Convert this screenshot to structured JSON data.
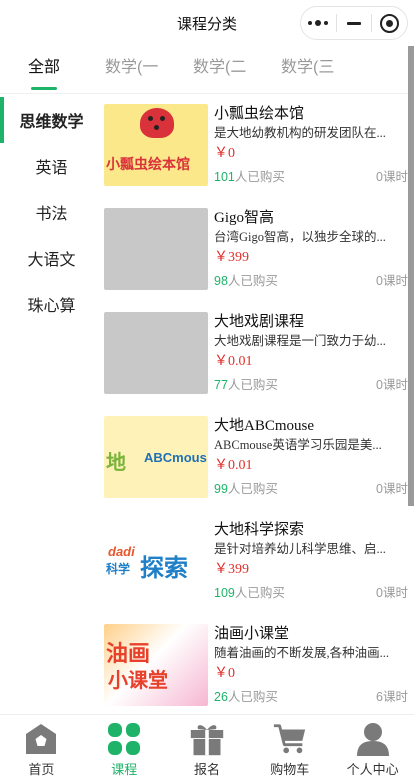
{
  "header": {
    "title": "课程分类"
  },
  "tabs": [
    {
      "label": "全部",
      "active": true
    },
    {
      "label": "数学(一",
      "active": false
    },
    {
      "label": "数学(二",
      "active": false
    },
    {
      "label": "数学(三",
      "active": false
    }
  ],
  "sidebar": {
    "items": [
      {
        "label": "思维数学",
        "active": true
      },
      {
        "label": "英语",
        "active": false
      },
      {
        "label": "书法",
        "active": false
      },
      {
        "label": "大语文",
        "active": false
      },
      {
        "label": "珠心算",
        "active": false
      }
    ]
  },
  "courses": [
    {
      "name": "小瓢虫绘本馆",
      "desc": "是大地幼教机构的研发团队在...",
      "price": "￥0",
      "count": "101",
      "count_suffix": "人已购买",
      "lessons": "0课时",
      "thumb_text": "小瓢虫绘本馆"
    },
    {
      "name": "Gigo智高",
      "desc": "台湾Gigo智高，以独步全球的...",
      "price": "￥399",
      "count": "98",
      "count_suffix": "人已购买",
      "lessons": "0课时"
    },
    {
      "name": "大地戏剧课程",
      "desc": "大地戏剧课程是一门致力于幼...",
      "price": "￥0.01",
      "count": "77",
      "count_suffix": "人已购买",
      "lessons": "0课时"
    },
    {
      "name": "大地ABCmouse",
      "desc": "ABCmouse英语学习乐园是美...",
      "price": "￥0.01",
      "count": "99",
      "count_suffix": "人已购买",
      "lessons": "0课时",
      "thumb_text_a": "地",
      "thumb_text_b": "ABCmous"
    },
    {
      "name": "大地科学探索",
      "desc": "是针对培养幼儿科学思维、启...",
      "price": "￥399",
      "count": "109",
      "count_suffix": "人已购买",
      "lessons": "0课时",
      "thumb_text_a": "dadi",
      "thumb_text_b": "科学",
      "thumb_text_c": "探索"
    },
    {
      "name": "油画小课堂",
      "desc": "随着油画的不断发展,各种油画...",
      "price": "￥0",
      "count": "26",
      "count_suffix": "人已购买",
      "lessons": "6课时",
      "thumb_text_a": "油画",
      "thumb_text_b": "小课堂"
    }
  ],
  "bottom_nav": [
    {
      "label": "首页",
      "icon": "home-icon",
      "active": false
    },
    {
      "label": "课程",
      "icon": "grid-icon",
      "active": true
    },
    {
      "label": "报名",
      "icon": "gift-icon",
      "active": false
    },
    {
      "label": "购物车",
      "icon": "cart-icon",
      "active": false
    },
    {
      "label": "个人中心",
      "icon": "user-icon",
      "active": false
    }
  ],
  "colors": {
    "accent": "#1fb36a",
    "price": "#e1302a",
    "muted": "#9a9a9a",
    "nav_icon": "#7a7a7a"
  }
}
